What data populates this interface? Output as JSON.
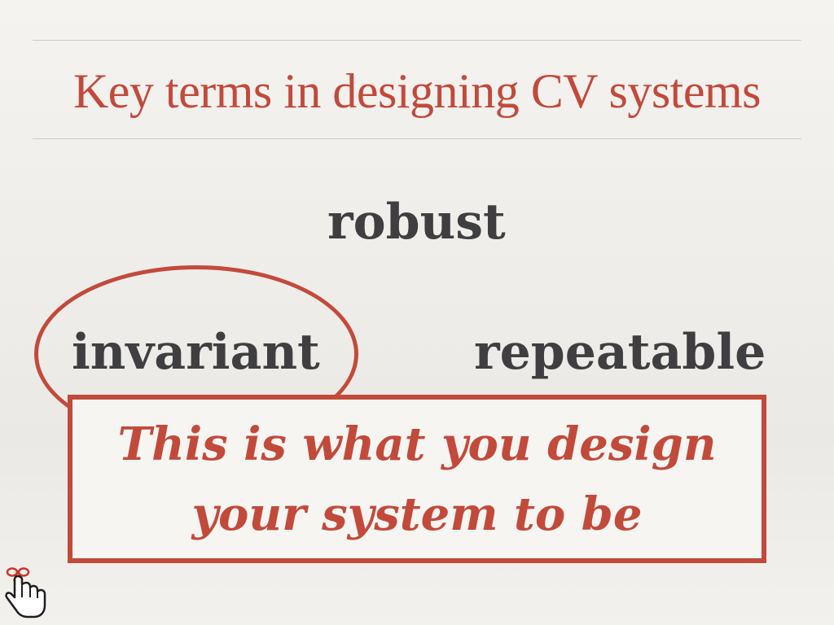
{
  "slide": {
    "title": "Key terms in designing CV systems",
    "terms": {
      "robust": "robust",
      "invariant": "invariant",
      "repeatable": "repeatable"
    },
    "callout_line1": "This is what you design",
    "callout_line2": "your system to be",
    "icons": [
      "hand-pointer-with-ribbon-icon"
    ]
  },
  "colors": {
    "accent": "#c24a3b",
    "text": "#3f3e40",
    "background": "#f3f1ee"
  }
}
